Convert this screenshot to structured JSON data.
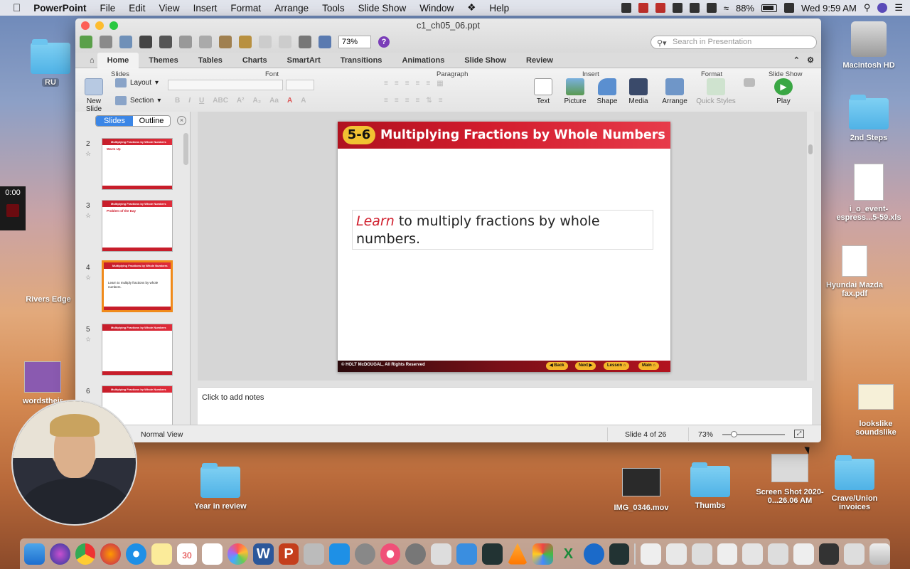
{
  "menubar": {
    "app": "PowerPoint",
    "items": [
      "File",
      "Edit",
      "View",
      "Insert",
      "Format",
      "Arrange",
      "Tools",
      "Slide Show",
      "Window",
      "Help"
    ],
    "battery": "88%",
    "clock": "Wed 9:59 AM"
  },
  "window": {
    "title": "c1_ch05_06.ppt",
    "zoom": "73%",
    "search_placeholder": "Search in Presentation"
  },
  "ribbon": {
    "tabs": [
      "Home",
      "Themes",
      "Tables",
      "Charts",
      "SmartArt",
      "Transitions",
      "Animations",
      "Slide Show",
      "Review"
    ],
    "groups": {
      "slides": "Slides",
      "font": "Font",
      "paragraph": "Paragraph",
      "insert": "Insert",
      "format": "Format",
      "slideshow": "Slide Show"
    },
    "buttons": {
      "new_slide": "New Slide",
      "layout": "Layout",
      "section": "Section",
      "text": "Text",
      "picture": "Picture",
      "shape": "Shape",
      "media": "Media",
      "arrange": "Arrange",
      "quick_styles": "Quick Styles",
      "play": "Play"
    }
  },
  "sidebar": {
    "tab_slides": "Slides",
    "tab_outline": "Outline",
    "thumbs": [
      {
        "num": "2",
        "title": "Multiplying Fractions by Whole Numbers",
        "body": "Warm Up"
      },
      {
        "num": "3",
        "title": "Multiplying Fractions by Whole Numbers",
        "body": "Problem of the Day"
      },
      {
        "num": "4",
        "title": "Multiplying Fractions by Whole Numbers",
        "body": "Learn to multiply fractions by whole numbers."
      },
      {
        "num": "5",
        "title": "Multiplying Fractions by Whole Numbers",
        "body": ""
      },
      {
        "num": "6",
        "title": "Multiplying Fractions by Whole Numbers",
        "body": ""
      }
    ]
  },
  "slide": {
    "badge": "5-6",
    "title": "Multiplying Fractions by Whole Numbers",
    "body_em": "Learn",
    "body_rest": " to multiply fractions by whole numbers.",
    "copyright": "© HOLT McDOUGAL, All Rights Reserved",
    "nav": [
      "Back",
      "Next",
      "Lesson",
      "Main"
    ]
  },
  "notes_placeholder": "Click to add notes",
  "status": {
    "view": "Normal View",
    "slide_of": "Slide 4 of 26",
    "zoom": "73%"
  },
  "recorder_time": "0:00",
  "desktop": {
    "right_icons": [
      "Macintosh HD",
      "2nd Steps",
      "i_o_event-espress...5-59.xls",
      "Hyundai Mazda fax.pdf",
      "lookslike soundslike",
      "Crave/Union invoices",
      "Screen Shot 2020-0...26.06 AM",
      "Thumbs",
      "IMG_0346.mov",
      "Year in review"
    ],
    "left_icons": [
      "RU",
      "Rivers Edge",
      "wordstheir"
    ]
  }
}
